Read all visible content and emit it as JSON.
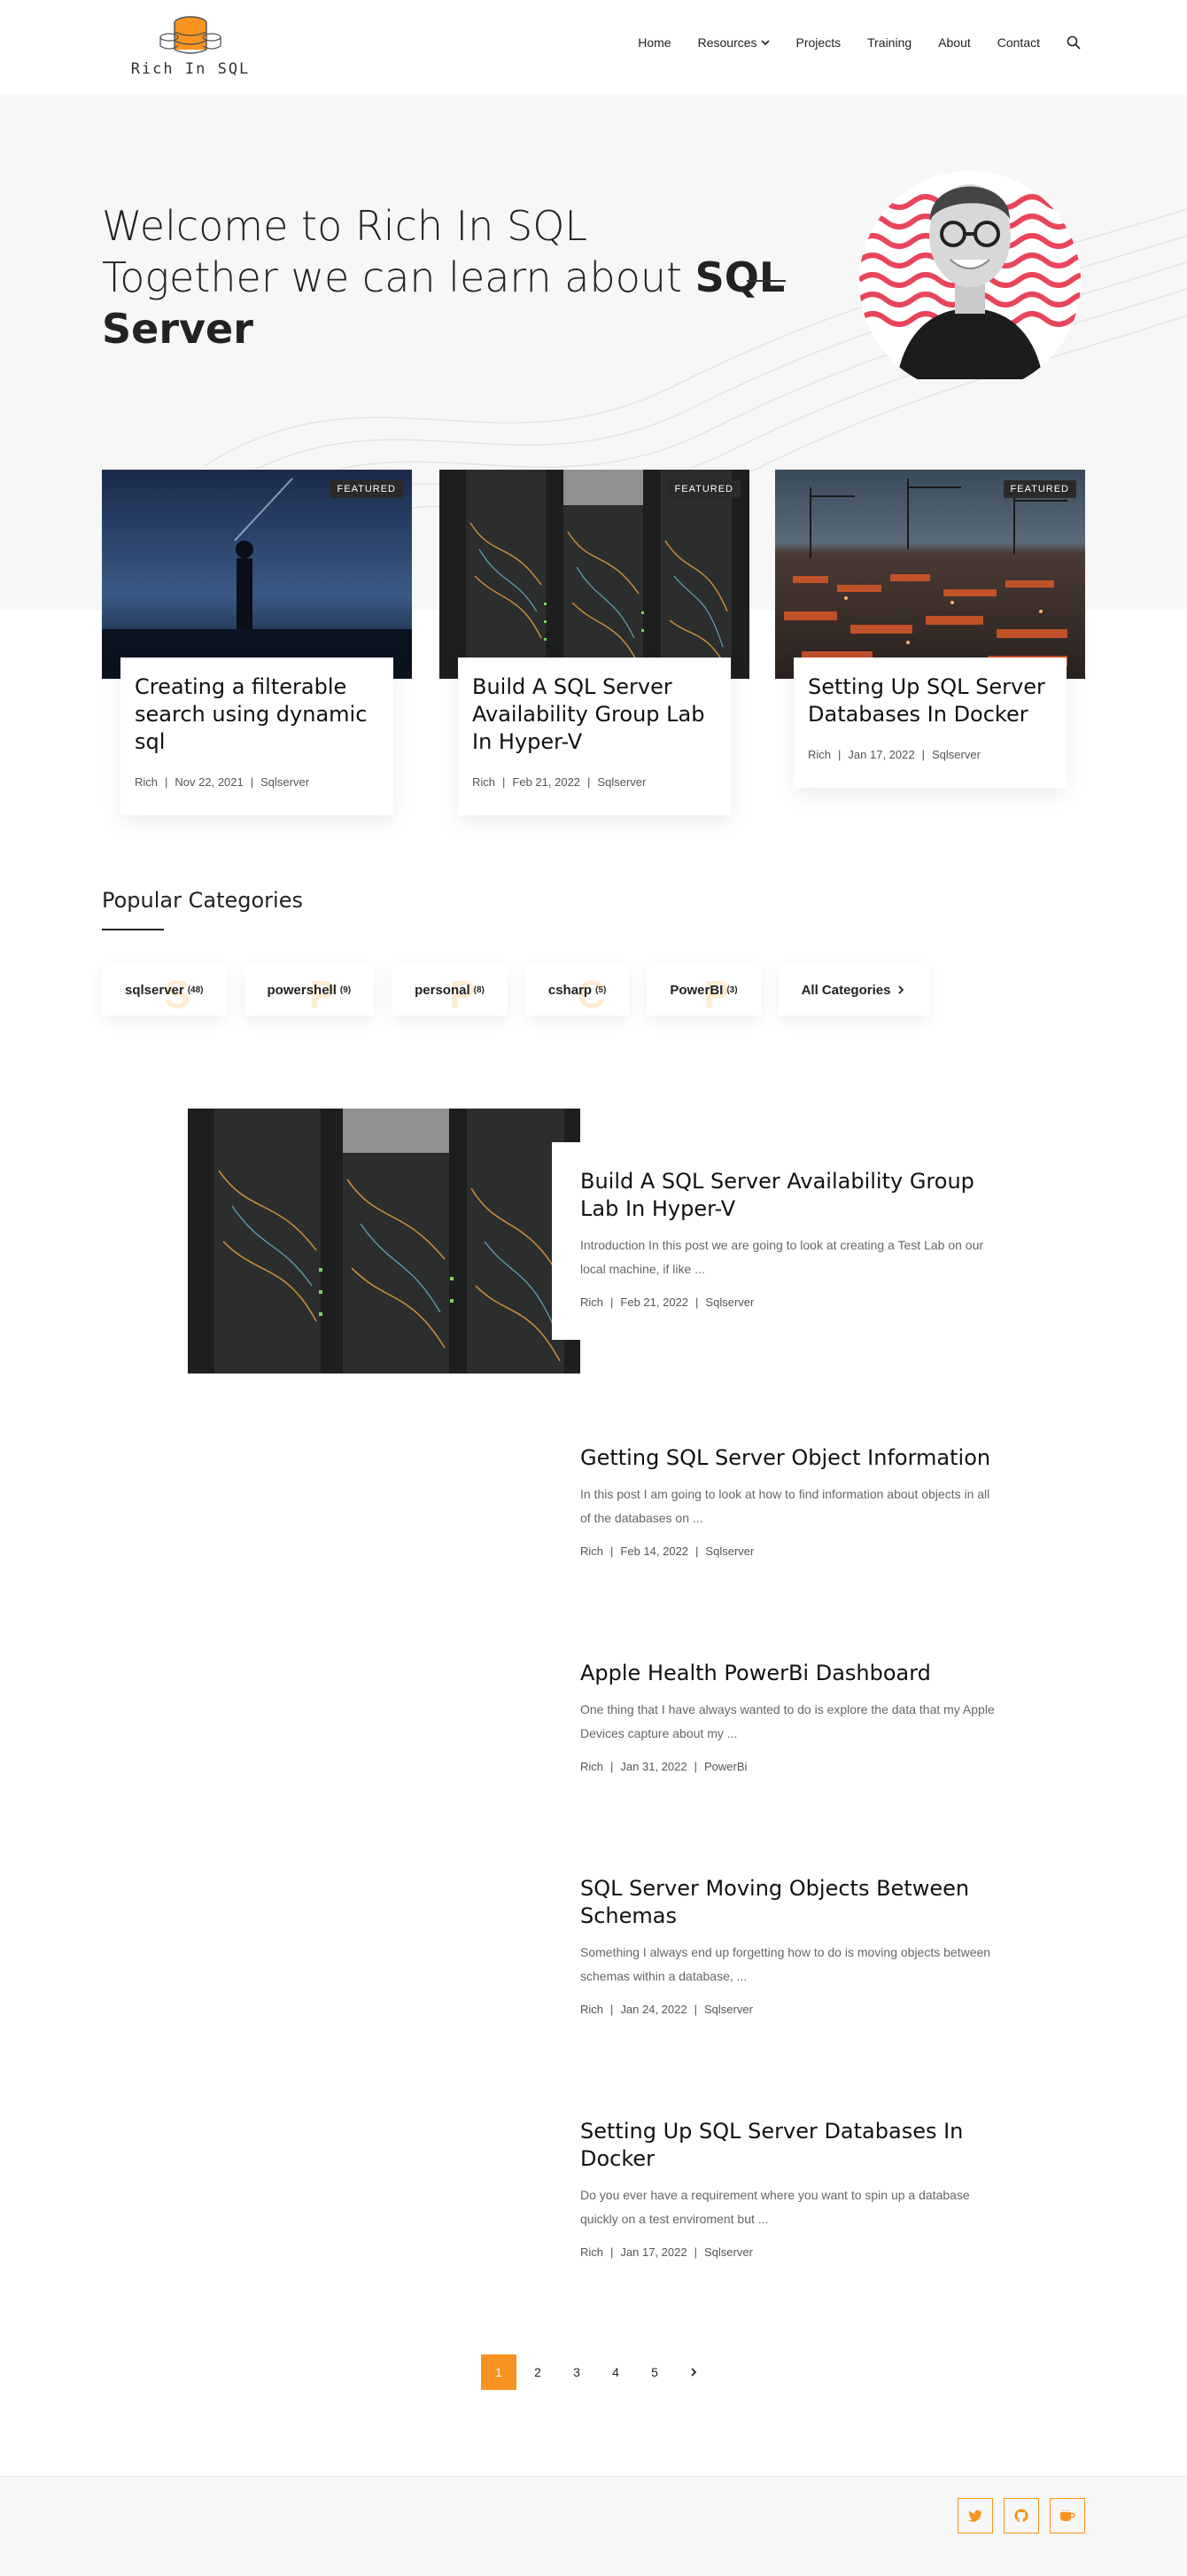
{
  "brand": {
    "logo_text": "Rich In SQL",
    "accent": "#f7931e"
  },
  "nav": {
    "items": [
      "Home",
      "Resources",
      "Projects",
      "Training",
      "About",
      "Contact"
    ],
    "resources_chevron": "chevron-down-icon",
    "search_icon": "search-icon"
  },
  "hero": {
    "title": "Welcome to Rich In SQL",
    "subtitle_prefix": "Together we can learn about ",
    "subtitle_bold": "SQL Server"
  },
  "featured": [
    {
      "badge": "FEATURED",
      "title": "Creating a filterable search using dynamic sql",
      "author": "Rich",
      "date": "Nov 22, 2021",
      "category": "Sqlserver"
    },
    {
      "badge": "FEATURED",
      "title": "Build A SQL Server Availability Group Lab In Hyper-V",
      "author": "Rich",
      "date": "Feb 21, 2022",
      "category": "Sqlserver"
    },
    {
      "badge": "FEATURED",
      "title": "Setting Up SQL Server Databases In Docker",
      "author": "Rich",
      "date": "Jan 17, 2022",
      "category": "Sqlserver"
    }
  ],
  "categories": {
    "heading": "Popular Categories",
    "items": [
      {
        "label": "sqlserver",
        "count": "(48)",
        "ghost": "S"
      },
      {
        "label": "powershell",
        "count": "(9)",
        "ghost": "P"
      },
      {
        "label": "personal",
        "count": "(8)",
        "ghost": "P"
      },
      {
        "label": "csharp",
        "count": "(5)",
        "ghost": "C"
      },
      {
        "label": "PowerBI",
        "count": "(3)",
        "ghost": "P"
      }
    ],
    "all_label": "All Categories"
  },
  "posts": [
    {
      "title": "Build A SQL Server Availability Group Lab In Hyper-V",
      "excerpt": "Introduction In this post we are going to look at creating a Test Lab on our local machine, if like ...",
      "author": "Rich",
      "date": "Feb 21, 2022",
      "category": "Sqlserver"
    },
    {
      "title": "Getting SQL Server Object Information",
      "excerpt": "In this post I am going to look at how to find information about objects in all of the databases on ...",
      "author": "Rich",
      "date": "Feb 14, 2022",
      "category": "Sqlserver"
    },
    {
      "title": "Apple Health PowerBi Dashboard",
      "excerpt": "One thing that I have always wanted to do is explore the data that my Apple Devices capture about my ...",
      "author": "Rich",
      "date": "Jan 31, 2022",
      "category": "PowerBi"
    },
    {
      "title": "SQL Server Moving Objects Between Schemas",
      "excerpt": "Something I always end up forgetting how to do is moving objects between schemas within a database, ...",
      "author": "Rich",
      "date": "Jan 24, 2022",
      "category": "Sqlserver"
    },
    {
      "title": "Setting Up SQL Server Databases In Docker",
      "excerpt": "Do you ever have a requirement where you want to spin up a database quickly on a test enviroment but ...",
      "author": "Rich",
      "date": "Jan 17, 2022",
      "category": "Sqlserver"
    }
  ],
  "pagination": {
    "pages": [
      "1",
      "2",
      "3",
      "4",
      "5"
    ],
    "current": "1",
    "next_icon": "chevron-right-icon"
  },
  "footer": {
    "social": [
      "twitter-icon",
      "github-icon",
      "coffee-icon"
    ]
  },
  "meta_separator": "|"
}
